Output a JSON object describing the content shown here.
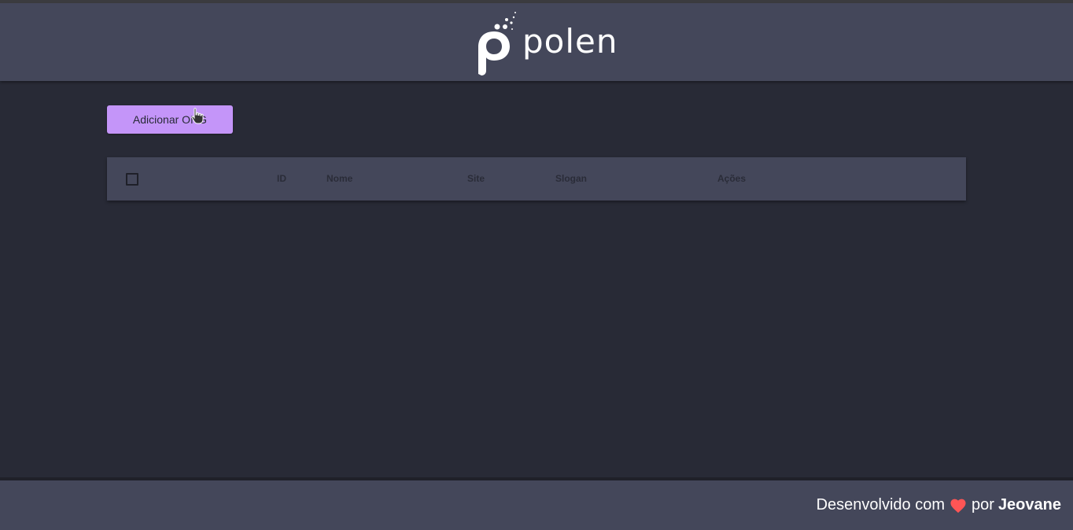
{
  "header": {
    "logo_text": "polen",
    "logo_icon": "polen-p-logo-icon"
  },
  "toolbar": {
    "add_button_label": "Adicionar ONG"
  },
  "table": {
    "columns": [
      "ID",
      "Nome",
      "Site",
      "Slogan",
      "Ações"
    ],
    "rows": []
  },
  "footer": {
    "prefix": "Desenvolvido com",
    "heart_icon": "heart-icon",
    "middle": "por",
    "author": "Jeovane"
  },
  "colors": {
    "background": "#282a36",
    "header": "#44475a",
    "accent": "#c495f9",
    "heart": "#ff5555"
  }
}
